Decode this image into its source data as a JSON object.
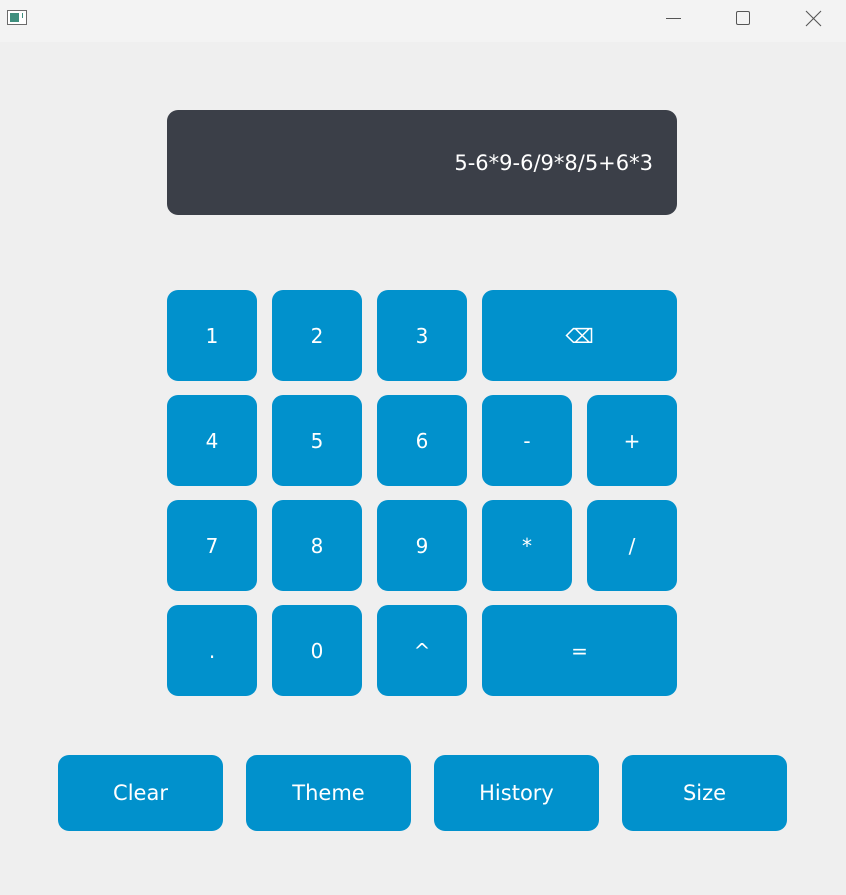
{
  "window": {
    "controls": {
      "minimize_icon": "minimize-icon",
      "maximize_icon": "maximize-icon",
      "close_icon": "close-icon"
    }
  },
  "display": {
    "expression": "5-6*9-6/9*8/5+6*3"
  },
  "keypad": {
    "k1": "1",
    "k2": "2",
    "k3": "3",
    "backspace": "⌫",
    "k4": "4",
    "k5": "5",
    "k6": "6",
    "minus": "-",
    "plus": "+",
    "k7": "7",
    "k8": "8",
    "k9": "9",
    "multiply": "*",
    "divide": "/",
    "dot": ".",
    "k0": "0",
    "power": "^",
    "equals": "="
  },
  "actions": {
    "clear": "Clear",
    "theme": "Theme",
    "history": "History",
    "size": "Size"
  },
  "colors": {
    "accent": "#0191cc",
    "display_bg": "#3b3f48",
    "window_bg": "#efefef"
  }
}
